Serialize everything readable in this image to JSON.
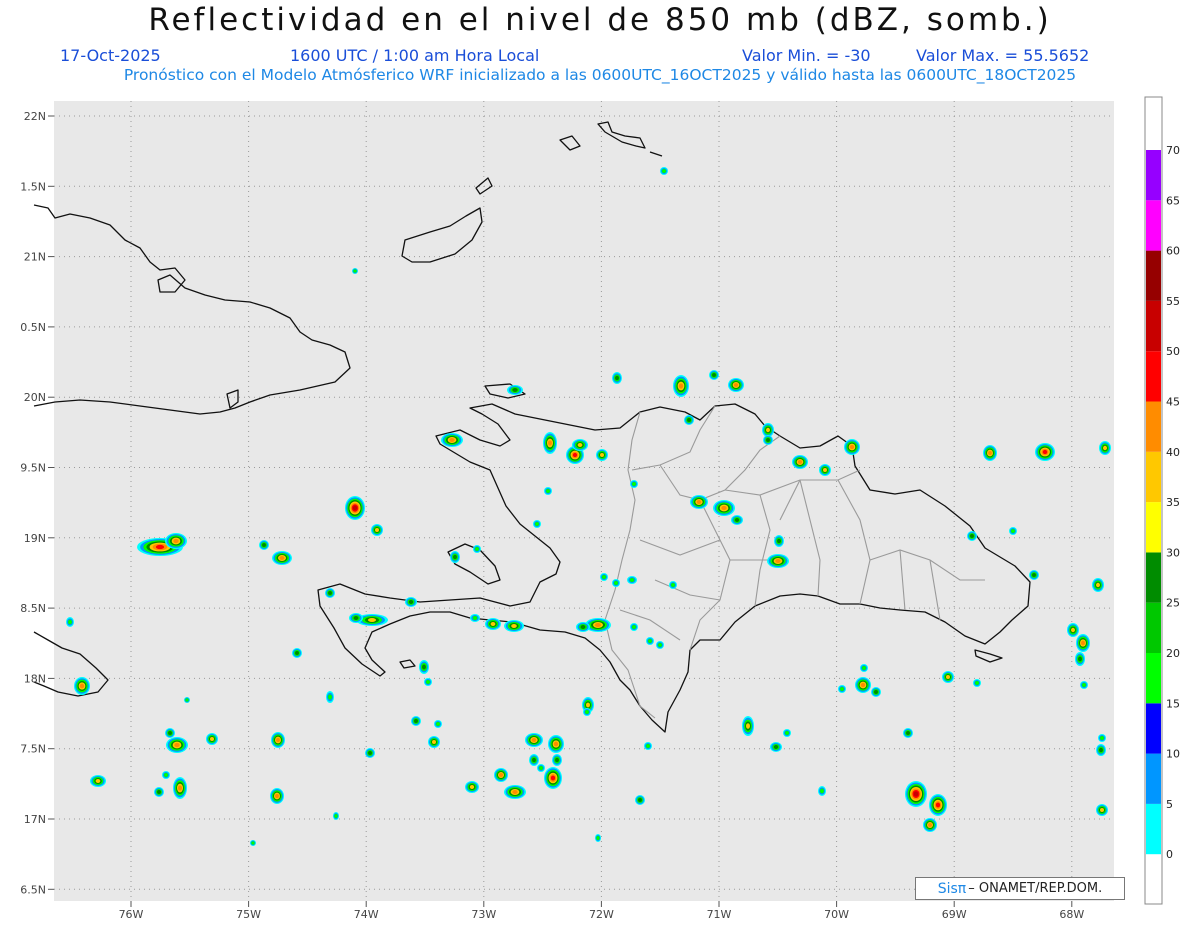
{
  "header": {
    "title": "Reflectividad en el nivel de 850 mb (dBZ, somb.)",
    "date": "17-Oct-2025",
    "time": "1600 UTC / 1:00 am Hora Local",
    "min_label": "Valor Min. = -30",
    "max_label": "Valor Max. = 55.5652",
    "subtitle": "Pronóstico con el Modelo Atmósferico WRF inicializado a las 0600UTC_16OCT2025 y válido hasta las  0600UTC_18OCT2025"
  },
  "axes": {
    "lat_labels": [
      "22N",
      "1.5N",
      "21N",
      "0.5N",
      "20N",
      "9.5N",
      "19N",
      "8.5N",
      "18N",
      "7.5N",
      "17N",
      "6.5N"
    ],
    "lon_labels": [
      "76W",
      "75W",
      "74W",
      "73W",
      "72W",
      "71W",
      "70W",
      "69W",
      "68W"
    ]
  },
  "colorbar": {
    "ticks": [
      "0",
      "5",
      "10",
      "15",
      "20",
      "25",
      "30",
      "35",
      "40",
      "45",
      "50",
      "55",
      "60",
      "65",
      "70"
    ],
    "colors": [
      "#00ffff",
      "#0096ff",
      "#0000ff",
      "#00ff00",
      "#00c800",
      "#008c00",
      "#ffff00",
      "#ffc800",
      "#ff8c00",
      "#ff0000",
      "#c80000",
      "#960000",
      "#ff00ff",
      "#9600ff"
    ]
  },
  "credit": {
    "logo": "Sisπ",
    "text": "– ONAMET/REP.DOM."
  }
}
